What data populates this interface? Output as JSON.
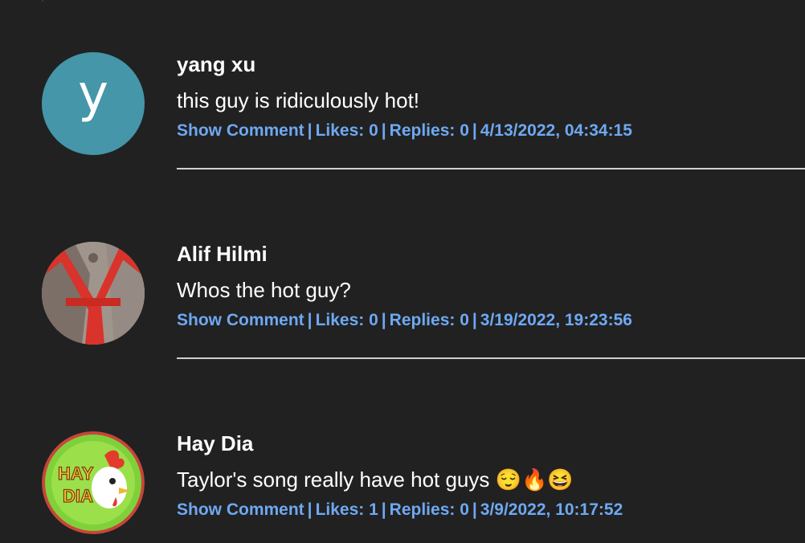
{
  "comments": [
    {
      "author": "yang xu",
      "avatar_letter": "y",
      "avatar_color": "#4496a8",
      "text": "this guy is ridiculously hot!",
      "show_comment": "Show Comment",
      "likes": "Likes: 0",
      "replies": "Replies: 0",
      "timestamp": "4/13/2022, 04:34:15"
    },
    {
      "author": "Alif Hilmi",
      "avatar_icon": "photo-avatar-red-straps",
      "text": "Whos the hot guy?",
      "show_comment": "Show Comment",
      "likes": "Likes: 0",
      "replies": "Replies: 0",
      "timestamp": "3/19/2022, 19:23:56"
    },
    {
      "author": "Hay Dia",
      "avatar_icon": "hay-day-logo-avatar",
      "avatar_logo_text": "HAY DIA",
      "text": "Taylor's song really have hot guys 😌🔥😆",
      "show_comment": "Show Comment",
      "likes": "Likes: 1",
      "replies": "Replies: 0",
      "timestamp": "3/9/2022, 10:17:52"
    }
  ],
  "colors": {
    "background": "#212121",
    "link": "#6ea8f2",
    "divider": "#d0d0d0"
  }
}
